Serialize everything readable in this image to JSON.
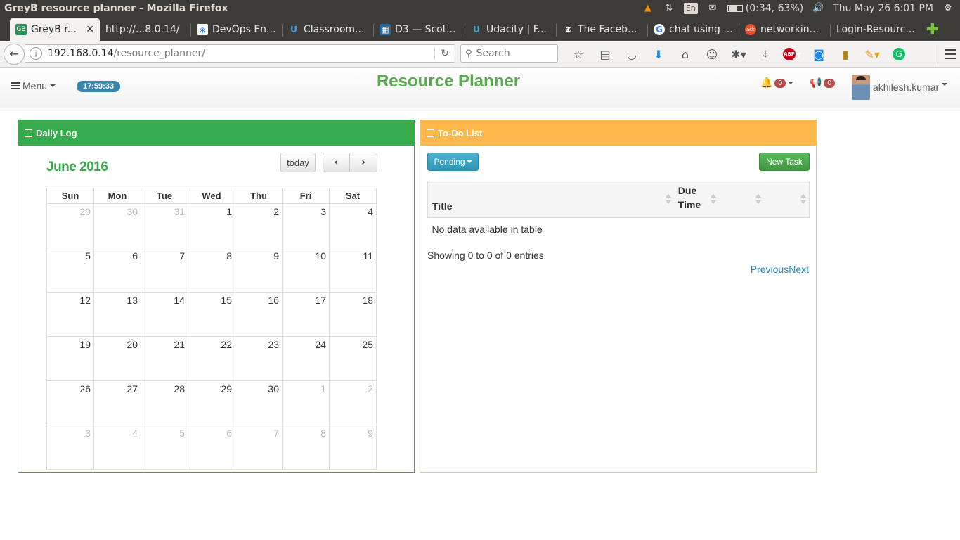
{
  "os": {
    "window_title": "GreyB resource planner - Mozilla Firefox",
    "battery": "(0:34, 63%)",
    "datetime": "Thu May 26  6:01 PM",
    "lang": "En"
  },
  "browser": {
    "tabs": [
      {
        "label": "GreyB r...",
        "icon": "greyb-icon",
        "active": true
      },
      {
        "label": "http://...8.0.14/",
        "icon": "",
        "active": false
      },
      {
        "label": "DevOps En...",
        "icon": "shield-icon",
        "active": false
      },
      {
        "label": "Classroom...",
        "icon": "udacity-icon",
        "active": false
      },
      {
        "label": "D3 — Scot...",
        "icon": "d3-icon",
        "active": false
      },
      {
        "label": "Udacity | F...",
        "icon": "udacity-icon",
        "active": false
      },
      {
        "label": "The Faceb...",
        "icon": "nyt-icon",
        "active": false
      },
      {
        "label": "chat using ...",
        "icon": "google-icon",
        "active": false
      },
      {
        "label": "networkin...",
        "icon": "ask-icon",
        "active": false
      },
      {
        "label": "Login-Resourc...",
        "icon": "",
        "active": false
      }
    ],
    "url_host": "192.168.0.14",
    "url_path": "/resource_planner/",
    "search_placeholder": "Search"
  },
  "header": {
    "menu_label": "Menu",
    "clock": "17:59:33",
    "title": "Resource Planner",
    "notifications_count": "0",
    "announcements_count": "0",
    "username": "akhilesh.kumar"
  },
  "daily_log": {
    "heading": "Daily Log",
    "month_title": "June 2016",
    "today_label": "today",
    "prev_label": "‹",
    "next_label": "›",
    "weekdays": [
      "Sun",
      "Mon",
      "Tue",
      "Wed",
      "Thu",
      "Fri",
      "Sat"
    ],
    "weeks": [
      [
        "29",
        "30",
        "31",
        "1",
        "2",
        "3",
        "4"
      ],
      [
        "5",
        "6",
        "7",
        "8",
        "9",
        "10",
        "11"
      ],
      [
        "12",
        "13",
        "14",
        "15",
        "16",
        "17",
        "18"
      ],
      [
        "19",
        "20",
        "21",
        "22",
        "23",
        "24",
        "25"
      ],
      [
        "26",
        "27",
        "28",
        "29",
        "30",
        "1",
        "2"
      ],
      [
        "3",
        "4",
        "5",
        "6",
        "7",
        "8",
        "9"
      ]
    ]
  },
  "todo": {
    "heading": "To-Do List",
    "filter_label": "Pending",
    "new_task_label": "New Task",
    "columns": [
      "Title",
      "Due Time",
      "",
      ""
    ],
    "empty_message": "No data available in table",
    "info": "Showing 0 to 0 of 0 entries",
    "prev_label": "Previous",
    "next_label": "Next"
  }
}
